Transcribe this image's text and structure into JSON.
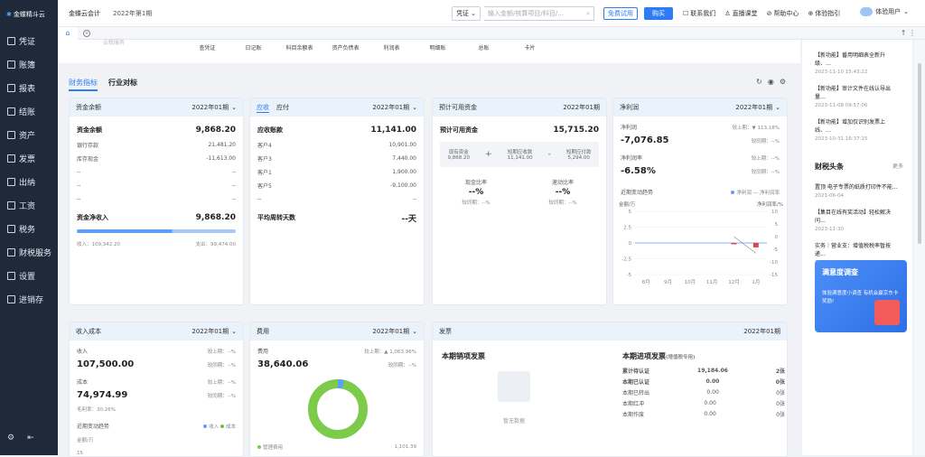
{
  "sidebar": {
    "logo": "金蝶精斗云",
    "items": [
      {
        "label": "凭证"
      },
      {
        "label": "账簿"
      },
      {
        "label": "报表"
      },
      {
        "label": "结账"
      },
      {
        "label": "资产"
      },
      {
        "label": "发票"
      },
      {
        "label": "出纳"
      },
      {
        "label": "工资"
      },
      {
        "label": "税务"
      },
      {
        "label": "财税服务"
      },
      {
        "label": "设置"
      },
      {
        "label": "进销存"
      }
    ],
    "bottom_icons": [
      "gear-icon",
      "collapse-icon"
    ]
  },
  "topbar": {
    "brand": "金蝶云会计",
    "period": "2022年第1期",
    "voucher_select": "凭证",
    "search_placeholder": "输入金额/核算项目/科目/…",
    "free_trial": "免费试用",
    "buy": "购买",
    "links": [
      "联系我们",
      "直播课堂",
      "帮助中心",
      "体验指引"
    ],
    "user": "体验用户"
  },
  "shortcuts": {
    "faded": "云税服务",
    "items": [
      "查凭证",
      "日记账",
      "科目余额表",
      "资产负债表",
      "利润表",
      "明细账",
      "总账",
      "卡片"
    ]
  },
  "section": {
    "tab_active": "财务指标",
    "tab_other": "行业对标"
  },
  "cards": {
    "fund": {
      "title": "资金余额",
      "period": "2022年01期",
      "label": "资金余额",
      "value": "9,868.20",
      "rows": [
        [
          "银行存款",
          "21,481.20"
        ],
        [
          "库存现金",
          "-11,613.00"
        ],
        [
          "--",
          "--"
        ],
        [
          "--",
          "--"
        ],
        [
          "--",
          "--"
        ]
      ],
      "net_label": "资金净收入",
      "net_value": "9,868.20",
      "in_label": "收入：",
      "in_value": "109,342.20",
      "out_label": "支出：",
      "out_value": "99,474.00"
    },
    "recv": {
      "tab1": "应收",
      "tab2": "应付",
      "period": "2022年01期",
      "label": "应收账款",
      "value": "11,141.00",
      "rows": [
        [
          "客户4",
          "10,901.00"
        ],
        [
          "客户3",
          "7,440.00"
        ],
        [
          "客户1",
          "1,900.00"
        ],
        [
          "客户5",
          "-9,100.00"
        ],
        [
          "--",
          "--"
        ]
      ],
      "days_label": "平均周转天数",
      "days_value": "--天"
    },
    "avail": {
      "title": "预计可用资金",
      "period": "2022年01期",
      "label": "预计可用资金",
      "value": "15,715.20",
      "a1": "现有资金",
      "a1v": "9,868.20",
      "a2": "短期应收款",
      "a2v": "11,141.00",
      "a3": "短期应付款",
      "a3v": "5,294.00",
      "r1": "现金比率",
      "r1v": "--%",
      "r2": "速动比率",
      "r2v": "--%",
      "cmp": "较同期：--%"
    },
    "profit": {
      "title": "净利润",
      "period": "2022年01期",
      "label": "净利润",
      "value": "-7,076.85",
      "mom": "较上期：▼ 113.18%",
      "yoy": "较同期：--%",
      "rate_label": "净利润率",
      "rate": "-6.58%",
      "rate_mom": "较上期：--%",
      "rate_yoy": "较同期：--%",
      "trend": "近期变动趋势",
      "lg1": "净利润",
      "lg2": "净利润率",
      "yl": "金额/万",
      "yr": "净利润率/%"
    },
    "income": {
      "title": "收入成本",
      "period": "2022年01期",
      "in_label": "收入",
      "in_value": "107,500.00",
      "in_mom": "较上期：--%",
      "in_yoy": "较同期：--%",
      "cost_label": "成本",
      "cost_value": "74,974.99",
      "margin": "毛利率：30.26%",
      "cost_mom": "较上期：--%",
      "cost_yoy": "较同期：--%",
      "trend": "近期变动趋势",
      "lg1": "收入",
      "lg2": "成本",
      "yl": "金额/万",
      "first_tick": "15"
    },
    "expense": {
      "title": "费用",
      "period": "2022年01期",
      "label": "费用",
      "value": "38,640.06",
      "mom": "较上期：▲ 1,063.96%",
      "yoy": "较同期：--%",
      "legend": "管理费用",
      "legend_value": "1,101.39"
    },
    "invoice": {
      "title": "发票",
      "period": "2022年01期",
      "sale": "本期销项发票",
      "empty": "暂无数据",
      "purchase": "本期进项发票",
      "purchase_note": "(增值税专用)",
      "rows": [
        [
          "累计待认证",
          "19,184.06",
          "2张"
        ],
        [
          "本期已认证",
          "0.00",
          "0张"
        ],
        [
          "本期已转出",
          "0.00",
          "0张"
        ],
        [
          "本期红冲",
          "0.00",
          "0张"
        ],
        [
          "本期作废",
          "0.00",
          "0张"
        ]
      ]
    }
  },
  "chart_data": {
    "type": "line",
    "categories": [
      "8月",
      "9月",
      "10月",
      "11月",
      "12月",
      "1月"
    ],
    "yticks_left": [
      "5",
      "2.5",
      "0",
      "-2.5",
      "-5"
    ],
    "yticks_right": [
      "10",
      "5",
      "0",
      "-5",
      "-10",
      "-15"
    ],
    "ylabel_left": "金额/万",
    "ylabel_right": "净利润率/%",
    "series": [
      {
        "name": "净利润",
        "values": [
          null,
          null,
          null,
          null,
          0,
          -0.7
        ]
      },
      {
        "name": "净利润率",
        "values": [
          null,
          null,
          null,
          null,
          0,
          -6.58
        ]
      }
    ],
    "ylim": [
      -5,
      5
    ]
  },
  "news": {
    "items": [
      {
        "t": "【新功能】番用明细表全新升级、…",
        "d": "2023-11-10 15:43:22"
      },
      {
        "t": "【新功能】审计文件在线认导出量…",
        "d": "2023-11-08 09:57:06"
      },
      {
        "t": "【新功能】增加仅识别发票上线、…",
        "d": "2023-10-31 16:37:15"
      }
    ],
    "headline": "财税头条",
    "more": "更多",
    "heads": [
      {
        "t": "置顶 电子专票的纸质打印件不能…",
        "d": "2021-06-04"
      },
      {
        "t": "【集目在线有奖活动】轻松解决问…",
        "d": "2023-11-30"
      },
      {
        "t": "实务｜营业支：增值税税率暂按递…",
        "d": "2022-05-09"
      }
    ],
    "promo_title": "满意度调查",
    "promo_text": "体验满意度小调查 有机会赢京东卡奖励!"
  }
}
